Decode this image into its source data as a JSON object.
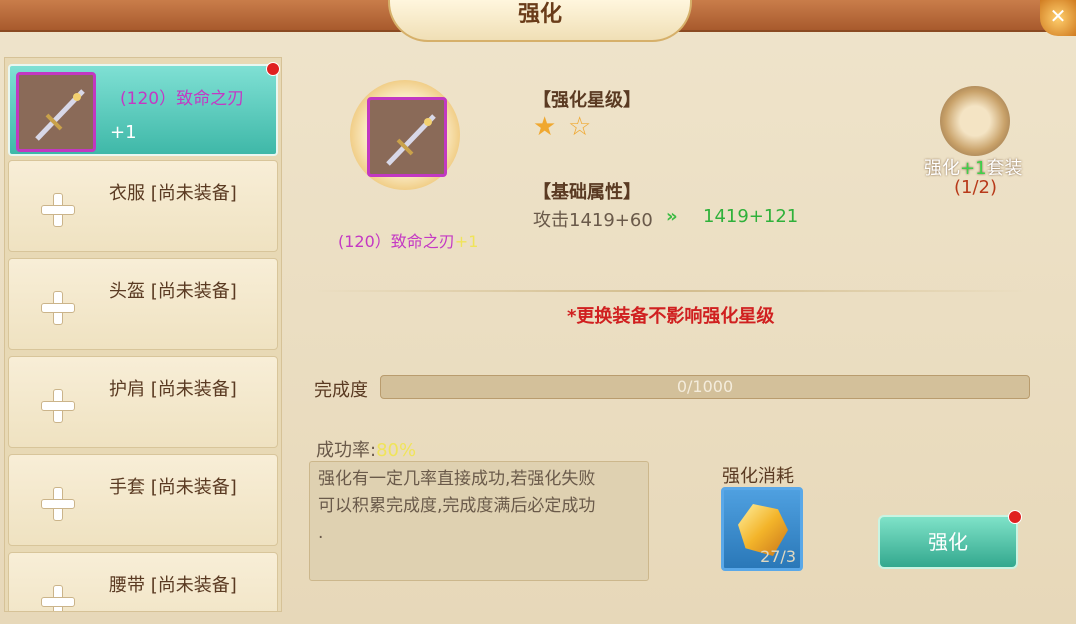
{
  "window": {
    "title": "强化",
    "close_icon": "close-icon"
  },
  "equipment_list": [
    {
      "name": "(120）致命之刃",
      "level": "+1",
      "selected": true,
      "has_red_dot": true
    },
    {
      "label": "衣服 [尚未装备]"
    },
    {
      "label": "头盔 [尚未装备]"
    },
    {
      "label": "护肩 [尚未装备]"
    },
    {
      "label": "手套 [尚未装备]"
    },
    {
      "label": "腰带 [尚未装备]"
    }
  ],
  "selected_item": {
    "name": "(120）致命之刃",
    "plus": "+1"
  },
  "star_section": {
    "title": "【强化星级】",
    "stars_filled": 1,
    "stars_total": 2
  },
  "attr_section": {
    "title": "【基础属性】",
    "current": "攻击1419+60",
    "next": "1419+121"
  },
  "set_bonus": {
    "label_prefix": "强化",
    "label_plus": "+1",
    "label_suffix": "套装",
    "count": "(1/2)"
  },
  "notice": "*更换装备不影响强化星级",
  "progress": {
    "label": "完成度",
    "text": "0/1000",
    "fraction": 0
  },
  "success": {
    "label": "成功率:",
    "value": "80%"
  },
  "description": {
    "line1": "强化有一定几率直接成功,若强化失败",
    "line2": "可以积累完成度,完成度满后必定成功",
    "line3": "."
  },
  "cost": {
    "title": "强化消耗",
    "count": "27/3"
  },
  "action": {
    "button_label": "强化"
  },
  "colors": {
    "accent": "#3fb8a8",
    "item_name": "#c438c4",
    "success_rate": "#f0e45a",
    "notice": "#d02020"
  }
}
